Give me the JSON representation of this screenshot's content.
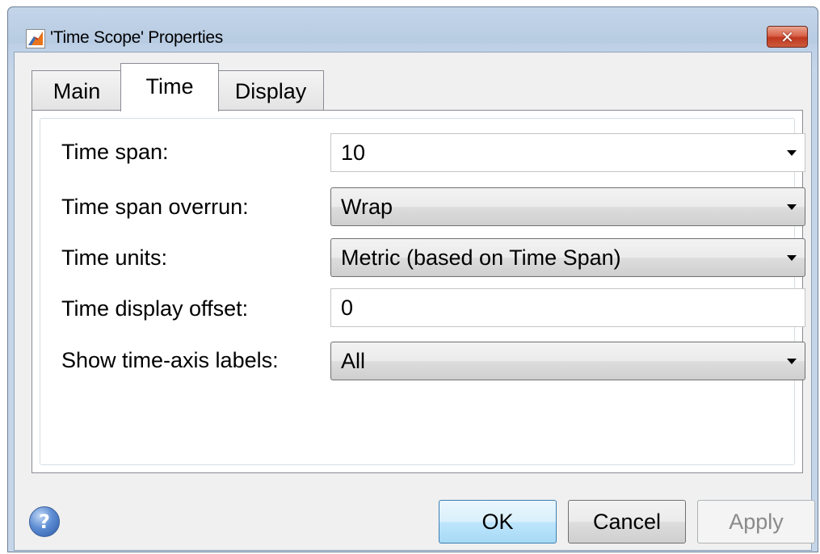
{
  "window": {
    "title": "'Time Scope' Properties",
    "close_symbol": "✕"
  },
  "tabs": [
    {
      "label": "Main",
      "active": false
    },
    {
      "label": "Time",
      "active": true
    },
    {
      "label": "Display",
      "active": false
    }
  ],
  "form": {
    "time_span": {
      "label": "Time span:",
      "value": "10"
    },
    "time_span_overrun": {
      "label": "Time span overrun:",
      "value": "Wrap"
    },
    "time_units": {
      "label": "Time units:",
      "value": "Metric (based on Time Span)"
    },
    "time_display_offset": {
      "label": "Time display offset:",
      "value": "0"
    },
    "show_time_axis_labels": {
      "label": "Show time-axis labels:",
      "value": "All"
    }
  },
  "footer": {
    "help_symbol": "?",
    "ok_label": "OK",
    "cancel_label": "Cancel",
    "apply_label": "Apply"
  },
  "colors": {
    "title_bar": "#c3d5e9",
    "close_button": "#c0391f",
    "ok_button_accent": "#3c7fb1"
  },
  "icons": {
    "app": "matlab-simulink-icon",
    "close": "close-icon",
    "help": "help-icon",
    "dropdown": "chevron-down-icon"
  }
}
